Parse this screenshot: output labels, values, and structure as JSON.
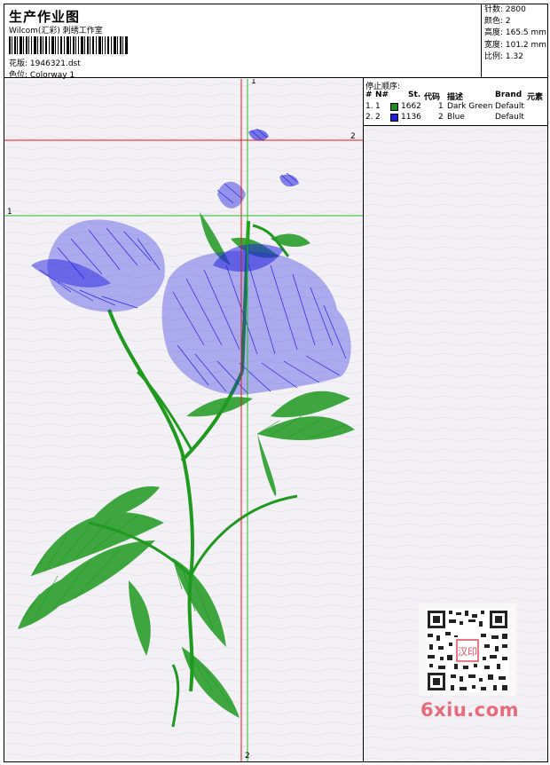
{
  "header": {
    "title": "生产作业图",
    "subtitle": "Wilcom(汇彩) 刺绣工作室",
    "file": "花版: 1946321.dst",
    "colorway": "色位: Colorway 1"
  },
  "stats": {
    "stitches": "针数: 2800",
    "colors": "颜色: 2",
    "height": "高度: 165.5 mm",
    "width": "宽度: 101.2 mm",
    "scale": "比例: 1.32"
  },
  "sequence": {
    "title": "停止顺序:",
    "columns": [
      "#",
      "N#",
      "St.",
      "代码",
      "描述",
      "Brand",
      "元素"
    ],
    "rows": [
      {
        "num": "1.",
        "n": "1",
        "color": "#1b8a1b",
        "stitches": "1662",
        "code": "1",
        "desc": "Dark Green",
        "brand": "Default"
      },
      {
        "num": "2.",
        "n": "2",
        "color": "#1f1fd6",
        "stitches": "1136",
        "code": "2",
        "desc": "Blue",
        "brand": "Default"
      }
    ]
  },
  "guides": {
    "v1": "1",
    "v2": "2",
    "h1": "1",
    "h2": "2"
  },
  "watermark": {
    "site": "6xiu.com",
    "seal": "汉印"
  },
  "colors": {
    "green_thread": "#1f9a1f",
    "blue_thread": "#2424e0",
    "guide_red": "#e01818",
    "guide_green": "#22c022"
  }
}
